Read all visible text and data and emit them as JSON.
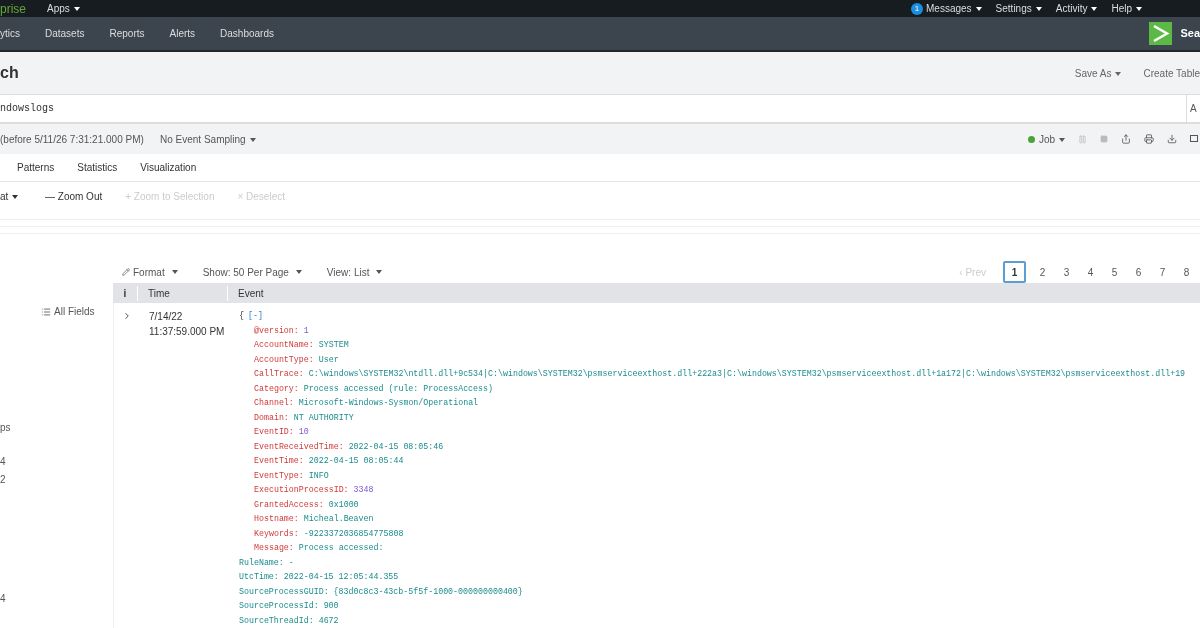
{
  "top_bar": {
    "brand": "prise",
    "apps": "Apps",
    "messages_count": "1",
    "menus": [
      "Messages",
      "Settings",
      "Activity",
      "Help"
    ]
  },
  "nav": {
    "items": [
      "ytics",
      "Datasets",
      "Reports",
      "Alerts",
      "Dashboards"
    ],
    "search_label": "Sea"
  },
  "page": {
    "title": "ch",
    "actions": [
      "Save As",
      "Create Table"
    ]
  },
  "search": {
    "value": "ndowslogs",
    "button": "A"
  },
  "time_row": {
    "range": "(before 5/11/26 7:31:21.000 PM)",
    "sampling": "No Event Sampling",
    "job": "Job"
  },
  "tabs": [
    "Patterns",
    "Statistics",
    "Visualization"
  ],
  "timeline_toolbar": [
    {
      "label": "at",
      "dropdown": true,
      "disabled": false
    },
    {
      "label": "— Zoom Out",
      "dropdown": false,
      "disabled": false
    },
    {
      "label": "+ Zoom to Selection",
      "dropdown": false,
      "disabled": true
    },
    {
      "label": "× Deselect",
      "dropdown": false,
      "disabled": true
    }
  ],
  "results_toolbar": [
    {
      "label": "Format",
      "kind": "format"
    },
    {
      "label": "Show: 50 Per Page",
      "kind": "plain"
    },
    {
      "label": "View: List",
      "kind": "plain"
    }
  ],
  "pagination": {
    "prev": "‹ Prev",
    "prev_disabled": true,
    "pages": [
      {
        "label": "1",
        "selected": true
      },
      {
        "label": "2",
        "selected": false
      },
      {
        "label": "3",
        "selected": false
      },
      {
        "label": "4",
        "selected": false
      },
      {
        "label": "5",
        "selected": false
      },
      {
        "label": "6",
        "selected": false
      },
      {
        "label": "7",
        "selected": false
      },
      {
        "label": "8",
        "selected": false
      }
    ]
  },
  "sidebar": {
    "all_fields": "All Fields",
    "fragments": [
      "ps",
      "4",
      "2",
      "4"
    ]
  },
  "table": {
    "columns": [
      "i",
      "Time",
      "Event"
    ],
    "rows": [
      {
        "date": "7/14/22",
        "time": "11:37:59.000 PM",
        "open": "{",
        "toggle": "[-]",
        "lines": [
          {
            "kind": "number",
            "key": "@version:",
            "value": "1"
          },
          {
            "kind": "string",
            "key": "AccountName:",
            "value": "SYSTEM"
          },
          {
            "kind": "string",
            "key": "AccountType:",
            "value": "User"
          },
          {
            "kind": "string",
            "key": "CallTrace:",
            "value": "C:\\windows\\SYSTEM32\\ntdll.dll+9c534|C:\\windows\\SYSTEM32\\psmserviceexthost.dll+222a3|C:\\windows\\SYSTEM32\\psmserviceexthost.dll+1a172|C:\\windows\\SYSTEM32\\psmserviceexthost.dll+19"
          },
          {
            "kind": "string",
            "key": "Category:",
            "value": "Process accessed (rule: ProcessAccess)"
          },
          {
            "kind": "string",
            "key": "Channel:",
            "value": "Microsoft-Windows-Sysmon/Operational"
          },
          {
            "kind": "string",
            "key": "Domain:",
            "value": "NT AUTHORITY"
          },
          {
            "kind": "number",
            "key": "EventID:",
            "value": "10"
          },
          {
            "kind": "string",
            "key": "EventReceivedTime:",
            "value": "2022-04-15 08:05:46"
          },
          {
            "kind": "string",
            "key": "EventTime:",
            "value": "2022-04-15 08:05:44"
          },
          {
            "kind": "string",
            "key": "EventType:",
            "value": "INFO"
          },
          {
            "kind": "number",
            "key": "ExecutionProcessID:",
            "value": "3348"
          },
          {
            "kind": "string",
            "key": "GrantedAccess:",
            "value": "0x1000"
          },
          {
            "kind": "string",
            "key": "Hostname:",
            "value": "Micheal.Beaven"
          },
          {
            "kind": "string",
            "key": "Keywords:",
            "value": "-9223372036854775808"
          },
          {
            "kind": "string",
            "key": "Message:",
            "value": "Process accessed:"
          },
          {
            "kind": "text",
            "text": "RuleName: -"
          },
          {
            "kind": "text",
            "text": "UtcTime: 2022-04-15 12:05:44.355"
          },
          {
            "kind": "text",
            "text": "SourceProcessGUID: {83d0c8c3-43cb-5f5f-1000-000000000400}"
          },
          {
            "kind": "text",
            "text": "SourceProcessId: 900"
          },
          {
            "kind": "text",
            "text": "SourceThreadId: 4672"
          }
        ]
      }
    ]
  }
}
